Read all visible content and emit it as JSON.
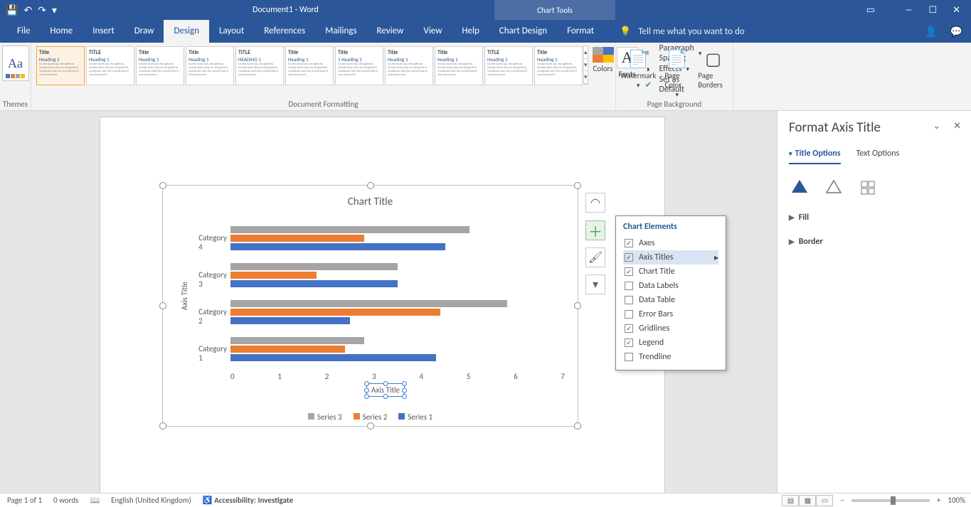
{
  "app": {
    "title": "Document1 - Word",
    "context_tab": "Chart Tools"
  },
  "qat": {
    "save": "💾",
    "undo": "↶",
    "redo": "↷",
    "more": "▾"
  },
  "tabs": [
    "File",
    "Home",
    "Insert",
    "Draw",
    "Design",
    "Layout",
    "References",
    "Mailings",
    "Review",
    "View",
    "Help",
    "Chart Design",
    "Format"
  ],
  "active_tab": "Design",
  "tell_me": "Tell me what you want to do",
  "ribbon": {
    "themes": {
      "label": "Themes"
    },
    "doc_fmt": {
      "label": "Document Formatting",
      "style_sets": [
        {
          "title": "Title",
          "h": "Heading 1"
        },
        {
          "title": "TITLE",
          "h": "Heading 1"
        },
        {
          "title": "Title",
          "h": "Heading 1"
        },
        {
          "title": "Title",
          "h": "Heading 1"
        },
        {
          "title": "TITLE",
          "h": "HEADING 1"
        },
        {
          "title": "Title",
          "h": "Heading 1"
        },
        {
          "title": "Title",
          "h": "1 Heading 1"
        },
        {
          "title": "Title",
          "h": "Heading 1"
        },
        {
          "title": "Title",
          "h": "Heading 1"
        },
        {
          "title": "TITLE",
          "h": "Heading 1"
        },
        {
          "title": "Title",
          "h": "Heading 1"
        }
      ],
      "colors": "Colors",
      "fonts": "Fonts",
      "paragraph_spacing": "Paragraph Spacing",
      "effects": "Effects",
      "set_default": "Set as Default"
    },
    "page_bg": {
      "label": "Page Background",
      "watermark": "Watermark",
      "page_color": "Page Color",
      "page_borders": "Page Borders"
    }
  },
  "chart_data": {
    "type": "bar",
    "orientation": "horizontal",
    "title": "Chart Title",
    "x_axis_title": "Axis Title",
    "y_axis_title": "Axis Title",
    "categories": [
      "Category 1",
      "Category 2",
      "Category 3",
      "Category 4"
    ],
    "series": [
      {
        "name": "Series 3",
        "color": "#a5a5a5",
        "values": [
          2.8,
          5.8,
          3.5,
          5.0
        ]
      },
      {
        "name": "Series 2",
        "color": "#ed7d31",
        "values": [
          2.4,
          4.4,
          1.8,
          2.8
        ]
      },
      {
        "name": "Series 1",
        "color": "#4472c4",
        "values": [
          4.3,
          2.5,
          3.5,
          4.5
        ]
      }
    ],
    "x_ticks": [
      0,
      1,
      2,
      3,
      4,
      5,
      6,
      7
    ],
    "xlim": [
      0,
      7
    ]
  },
  "chart_elements": {
    "header": "Chart Elements",
    "items": [
      {
        "label": "Axes",
        "checked": true
      },
      {
        "label": "Axis Titles",
        "checked": true,
        "hover": true
      },
      {
        "label": "Chart Title",
        "checked": true
      },
      {
        "label": "Data Labels",
        "checked": false
      },
      {
        "label": "Data Table",
        "checked": false
      },
      {
        "label": "Error Bars",
        "checked": false
      },
      {
        "label": "Gridlines",
        "checked": true
      },
      {
        "label": "Legend",
        "checked": true
      },
      {
        "label": "Trendline",
        "checked": false
      }
    ]
  },
  "pane": {
    "title": "Format Axis Title",
    "tabs": [
      "Title Options",
      "Text Options"
    ],
    "active": "Title Options",
    "sections": [
      "Fill",
      "Border"
    ]
  },
  "status": {
    "page": "Page 1 of 1",
    "words": "0 words",
    "lang": "English (United Kingdom)",
    "acc": "Accessibility: Investigate",
    "zoom": "100%"
  }
}
